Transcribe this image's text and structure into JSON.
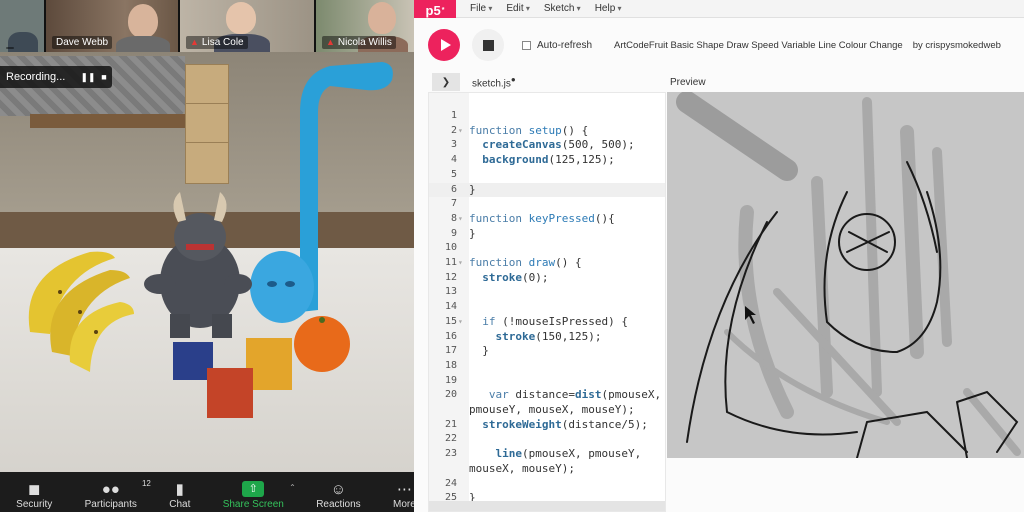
{
  "zoom": {
    "participants": [
      {
        "name": "",
        "muted": false
      },
      {
        "name": "Dave Webb",
        "muted": false
      },
      {
        "name": "Lisa Cole",
        "muted": true
      },
      {
        "name": "Nicola Willis",
        "muted": true
      }
    ],
    "recording": {
      "label": "Recording..."
    },
    "toolbar": {
      "security": "Security",
      "participants": "Participants",
      "participants_count": "12",
      "chat": "Chat",
      "share": "Share Screen",
      "reactions": "Reactions",
      "more": "More"
    }
  },
  "p5": {
    "logo": "p5",
    "menu": [
      "File",
      "Edit",
      "Sketch",
      "Help"
    ],
    "auto_refresh": "Auto-refresh",
    "sketch_title": "ArtCodeFruit Basic Shape Draw Speed Variable Line Colour Change",
    "author": "by crispysmokedweb",
    "file_tab": "sketch.js",
    "preview_label": "Preview",
    "canvas_bg": "#c6c6c6",
    "accent": "#ed225d",
    "code_lines": [
      {
        "n": "1",
        "fold": false,
        "text": ""
      },
      {
        "n": "2",
        "fold": true,
        "text": "function setup() {"
      },
      {
        "n": "3",
        "fold": false,
        "text": "  createCanvas(500, 500);"
      },
      {
        "n": "4",
        "fold": false,
        "text": "  background(125,125);"
      },
      {
        "n": "5",
        "fold": false,
        "text": ""
      },
      {
        "n": "6",
        "fold": false,
        "text": "}",
        "highlight": true
      },
      {
        "n": "7",
        "fold": false,
        "text": ""
      },
      {
        "n": "8",
        "fold": true,
        "text": "function keyPressed(){"
      },
      {
        "n": "9",
        "fold": false,
        "text": "}"
      },
      {
        "n": "10",
        "fold": false,
        "text": ""
      },
      {
        "n": "11",
        "fold": true,
        "text": "function draw() {"
      },
      {
        "n": "12",
        "fold": false,
        "text": "  stroke(0);"
      },
      {
        "n": "13",
        "fold": false,
        "text": ""
      },
      {
        "n": "14",
        "fold": false,
        "text": ""
      },
      {
        "n": "15",
        "fold": true,
        "text": "  if (!mouseIsPressed) {"
      },
      {
        "n": "16",
        "fold": false,
        "text": "    stroke(150,125);"
      },
      {
        "n": "17",
        "fold": false,
        "text": "  }"
      },
      {
        "n": "18",
        "fold": false,
        "text": ""
      },
      {
        "n": "19",
        "fold": false,
        "text": ""
      },
      {
        "n": "20",
        "fold": false,
        "text": "   var distance=dist(pmouseX,"
      },
      {
        "n": "",
        "fold": false,
        "text": "pmouseY, mouseX, mouseY);"
      },
      {
        "n": "21",
        "fold": false,
        "text": "  strokeWeight(distance/5);"
      },
      {
        "n": "22",
        "fold": false,
        "text": ""
      },
      {
        "n": "23",
        "fold": false,
        "text": "    line(pmouseX, pmouseY,"
      },
      {
        "n": "",
        "fold": false,
        "text": "mouseX, mouseY);"
      },
      {
        "n": "24",
        "fold": false,
        "text": ""
      },
      {
        "n": "25",
        "fold": false,
        "text": "}"
      }
    ]
  }
}
